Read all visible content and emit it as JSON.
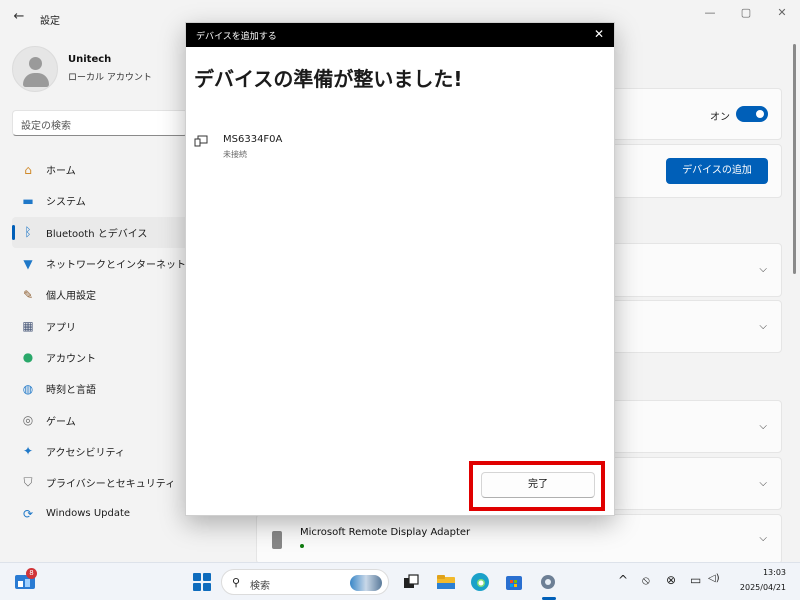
{
  "settings": {
    "title": "設定",
    "back_glyph": "←",
    "window_controls": [
      "—",
      "▢",
      "✕"
    ],
    "user": {
      "name": "Unitech",
      "account_type": "ローカル アカウント"
    },
    "search_placeholder": "設定の検索",
    "nav_items": [
      {
        "label": "ホーム",
        "icon": "home-icon",
        "glyph": "⌂",
        "color": "#d08a2a"
      },
      {
        "label": "システム",
        "icon": "system-icon",
        "glyph": "▬",
        "color": "#1f78c8"
      },
      {
        "label": "Bluetooth とデバイス",
        "icon": "bluetooth-icon",
        "glyph": "ᛒ",
        "color": "#1f78c8",
        "active": true
      },
      {
        "label": "ネットワークとインターネット",
        "icon": "wifi-icon",
        "glyph": "▼",
        "color": "#1f78c8"
      },
      {
        "label": "個人用設定",
        "icon": "brush-icon",
        "glyph": "✎",
        "color": "#8b5a2b"
      },
      {
        "label": "アプリ",
        "icon": "apps-icon",
        "glyph": "▦",
        "color": "#4a5a7a"
      },
      {
        "label": "アカウント",
        "icon": "account-icon",
        "glyph": "●",
        "color": "#2aa86a"
      },
      {
        "label": "時刻と言語",
        "icon": "globe-icon",
        "glyph": "◍",
        "color": "#1f78c8"
      },
      {
        "label": "ゲーム",
        "icon": "gamepad-icon",
        "glyph": "◎",
        "color": "#6a6a6a"
      },
      {
        "label": "アクセシビリティ",
        "icon": "accessibility-icon",
        "glyph": "✦",
        "color": "#1f78c8"
      },
      {
        "label": "プライバシーとセキュリティ",
        "icon": "shield-icon",
        "glyph": "⛉",
        "color": "#6a6a6a"
      },
      {
        "label": "Windows Update",
        "icon": "update-icon",
        "glyph": "⟳",
        "color": "#1f78c8"
      }
    ],
    "bluetooth_toggle": {
      "label": "オン",
      "on": true
    },
    "add_device_label": "デバイスの追加",
    "chevron_glyph": "⌵",
    "bottom_device": {
      "name": "Microsoft Remote Display Adapter"
    }
  },
  "dialog": {
    "title": "デバイスを追加する",
    "close_glyph": "✕",
    "heading": "デバイスの準備が整いました!",
    "device": {
      "name": "MS6334F0A",
      "status": "未接続"
    },
    "done_label": "完了"
  },
  "taskbar": {
    "widget_badge": "8",
    "search_icon_glyph": "⚲",
    "search_label": "検索",
    "tray_icons": [
      "^",
      "⦸",
      "⊗",
      "▭",
      "◁)"
    ],
    "time": "13:03",
    "date": "2025/04/21"
  },
  "colors": {
    "accent": "#005fb8",
    "highlight": "#e00000"
  }
}
